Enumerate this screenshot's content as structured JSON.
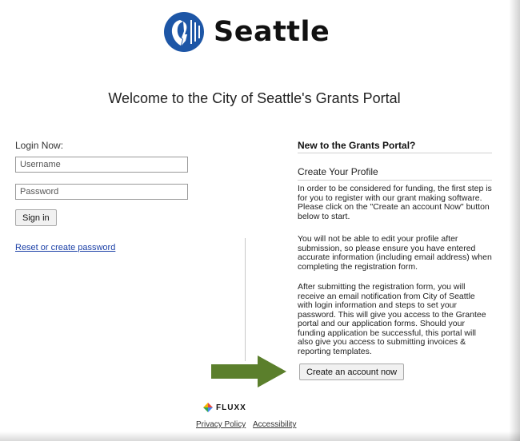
{
  "brand": {
    "logo_text": "Seattle",
    "logo_icon": "seattle-seal-icon"
  },
  "welcome": "Welcome to the City of Seattle's Grants Portal",
  "login": {
    "title": "Login Now:",
    "username_placeholder": "Username",
    "password_placeholder": "Password",
    "sign_in": "Sign in",
    "reset_link": "Reset or create password"
  },
  "signup": {
    "title": "New to the Grants Portal?",
    "subtitle": "Create Your Profile",
    "paragraphs": [
      "In order to be considered for funding, the first step is for you to register with our grant making software. Please click on the \"Create an account Now\" button below to start.",
      "You will not be able to edit your profile after submission, so please ensure you have entered accurate information (including email address) when completing the registration form.",
      "After submitting the registration form, you will receive an email notification from City of Seattle with login information and steps to set your password.  This will give you access to the Grantee portal and our application forms. Should your funding application be successful, this portal will also give you access to submitting invoices & reporting templates."
    ],
    "create_button": "Create an account now"
  },
  "footer": {
    "brand": "FLUXX",
    "privacy": "Privacy Policy",
    "accessibility": "Accessibility"
  },
  "colors": {
    "arrow": "#5b7f2c",
    "logo_blue": "#1d56a6",
    "link": "#1a3fa6"
  }
}
